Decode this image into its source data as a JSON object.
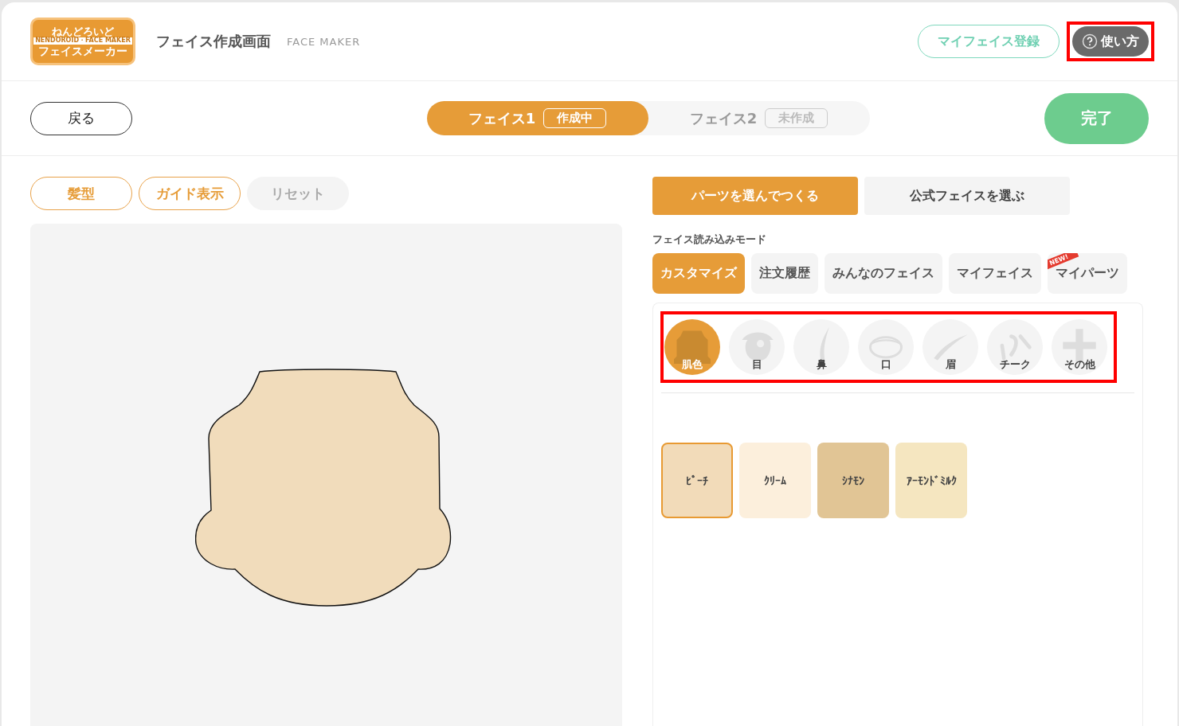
{
  "header": {
    "logo": {
      "line1": "ねんどろいど",
      "line2": "NENDOROID・FACE MAKER",
      "line3": "フェイスメーカー"
    },
    "title": "フェイス作成画面",
    "subtitle": "FACE MAKER",
    "register_button": "マイフェイス登録",
    "help_button": {
      "label": "使い方",
      "highlighted": true
    }
  },
  "nav": {
    "back_button": "戻る",
    "done_button": "完了",
    "face_tabs": [
      {
        "label": "フェイス1",
        "status": "作成中",
        "selected": true
      },
      {
        "label": "フェイス2",
        "status": "未作成",
        "selected": false
      }
    ]
  },
  "canvas_tools": [
    {
      "label": "髪型",
      "disabled": false
    },
    {
      "label": "ガイド表示",
      "disabled": false
    },
    {
      "label": "リセット",
      "disabled": true
    }
  ],
  "mode_tabs": [
    {
      "label": "パーツを選んでつくる",
      "selected": true
    },
    {
      "label": "公式フェイスを選ぶ",
      "selected": false
    }
  ],
  "load_mode": {
    "label": "フェイス読み込みモード",
    "options": [
      {
        "label": "カスタマイズ",
        "selected": true
      },
      {
        "label": "注文履歴",
        "selected": false
      },
      {
        "label": "みんなのフェイス",
        "selected": false
      },
      {
        "label": "マイフェイス",
        "selected": false
      },
      {
        "label": "マイパーツ",
        "selected": false,
        "badge": "NEW!"
      }
    ]
  },
  "parts": {
    "highlighted": true,
    "items": [
      {
        "kind": "skin",
        "label": "肌色",
        "selected": true
      },
      {
        "kind": "eye",
        "label": "目",
        "selected": false
      },
      {
        "kind": "nose",
        "label": "鼻",
        "selected": false
      },
      {
        "kind": "mouth",
        "label": "口",
        "selected": false
      },
      {
        "kind": "brow",
        "label": "眉",
        "selected": false
      },
      {
        "kind": "cheek",
        "label": "チーク",
        "selected": false
      },
      {
        "kind": "other",
        "label": "その他",
        "selected": false
      }
    ]
  },
  "swatches": [
    {
      "label": "ﾋﾟｰﾁ",
      "color": "#f2dbb9",
      "selected": true
    },
    {
      "label": "ｸﾘｰﾑ",
      "color": "#fcefdc",
      "selected": false
    },
    {
      "label": "ｼﾅﾓﾝ",
      "color": "#e1c595",
      "selected": false
    },
    {
      "label": "ｱｰﾓﾝﾄﾞﾐﾙｸ",
      "color": "#f5e6c0",
      "selected": false
    }
  ]
}
